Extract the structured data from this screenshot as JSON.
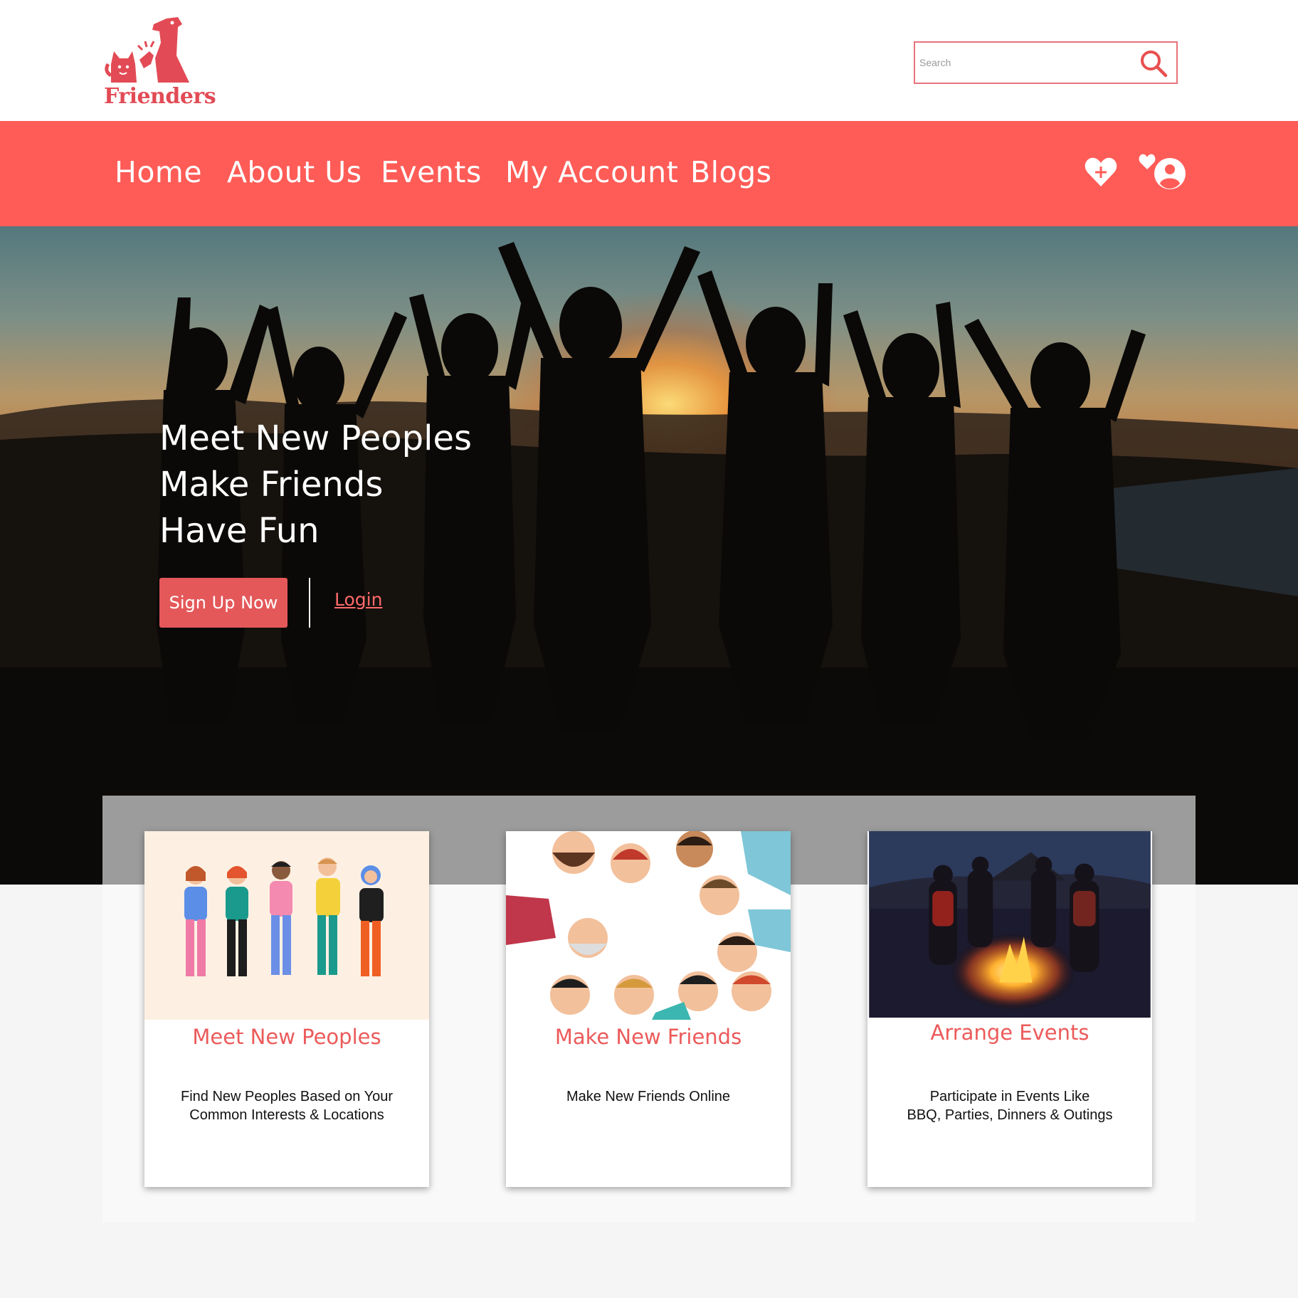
{
  "brand": {
    "name": "Frienders"
  },
  "search": {
    "placeholder": "Search",
    "value": ""
  },
  "nav": {
    "items": [
      {
        "label": "Home"
      },
      {
        "label": "About Us"
      },
      {
        "label": "Events"
      },
      {
        "label": "My Account"
      },
      {
        "label": "Blogs"
      }
    ],
    "icons": [
      "heart-plus-icon",
      "heart-user-icon"
    ]
  },
  "hero": {
    "lines": [
      "Meet New Peoples",
      "Make Friends",
      "Have Fun"
    ],
    "signup_label": "Sign Up Now",
    "login_label": "Login"
  },
  "cards": [
    {
      "title": "Meet New Peoples",
      "text_lines": [
        "Find New Peoples Based on Your",
        "Common Interests & Locations"
      ]
    },
    {
      "title": "Make New Friends",
      "text_lines": [
        "Make New Friends Online"
      ]
    },
    {
      "title": "Arrange Events",
      "text_lines": [
        "Participate in Events Like",
        "BBQ, Parties, Dinners & Outings"
      ]
    }
  ],
  "colors": {
    "brand": "#e24b55",
    "navbar": "#ff5c57",
    "button": "#e4585a",
    "card_title": "#ec5a5a",
    "login": "#ff6a6a"
  }
}
